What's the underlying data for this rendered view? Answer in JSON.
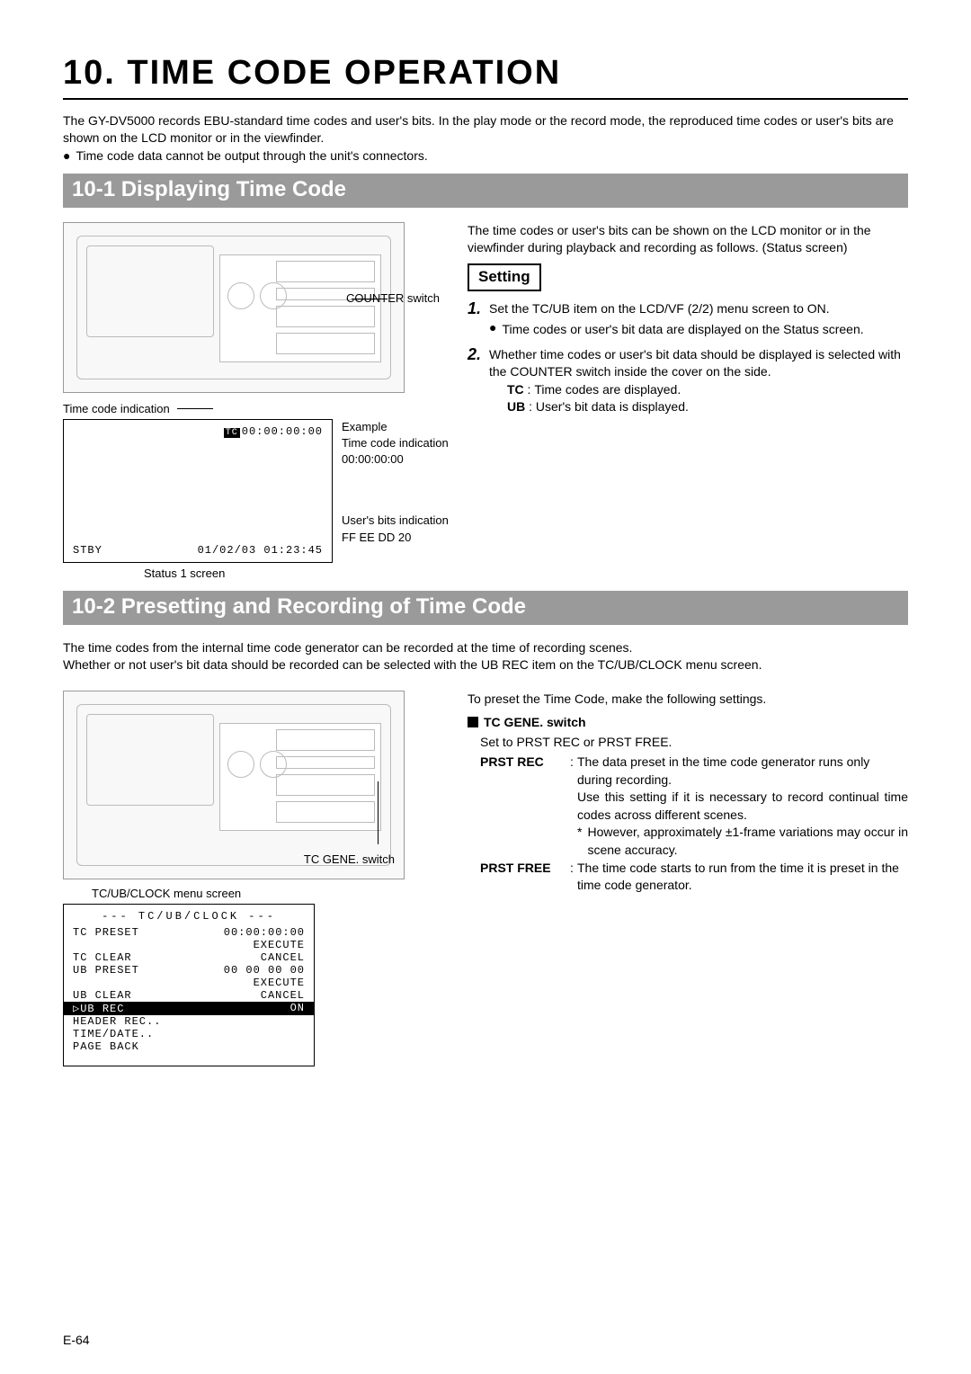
{
  "chapter": "10. TIME CODE OPERATION",
  "intro_p": "The GY-DV5000 records EBU-standard time codes and user's bits. In the play mode or the record mode, the reproduced time codes or user's bits are shown on the LCD monitor or in the viewfinder.",
  "intro_bullet": "Time code data cannot be output through the unit's connectors.",
  "sec1_bar": "10-1  Displaying Time Code",
  "sec1_right_intro": "The time codes or user's bits can be shown on the LCD monitor or in the viewfinder during playback and recording as follows. (Status screen)",
  "setting_label": "Setting",
  "step1_text": "Set the TC/UB item on the LCD/VF (2/2) menu screen to ON.",
  "step1_sub": "Time codes or user's bit data are displayed on the Status screen.",
  "step2_text": "Whether time codes or user's bit data should be displayed is selected with the COUNTER switch inside the cover on the side.",
  "step2_tc": "Time codes are displayed.",
  "step2_ub": "User's bit data is displayed.",
  "counter_switch_label": "COUNTER switch",
  "tc_indication_label": "Time code indication",
  "status_tc_value": "00:00:00:00",
  "status_stby": "STBY",
  "status_dt": "01/02/03 01:23:45",
  "status_caption": "Status 1 screen",
  "example_label": "Example",
  "example_tc_label": "Time code indication",
  "example_tc_val": "00:00:00:00",
  "example_ub_label": "User's bits indication",
  "example_ub_val": "FF EE DD 20",
  "sec2_bar": "10-2  Presetting and Recording of Time Code",
  "sec2_intro1": "The time codes from the internal time code generator can be recorded at the time of recording scenes.",
  "sec2_intro2": "Whether or not user's bit data should be recorded can be selected with the UB REC item on the TC/UB/CLOCK menu screen.",
  "preset_lead": "To preset the Time Code, make the following settings.",
  "tc_gene_hdr": "TC GENE. switch",
  "tc_gene_set": "Set to PRST REC or PRST FREE.",
  "prst_rec_label": "PRST REC",
  "prst_rec_1": "The data preset in the time code generator runs only during recording.",
  "prst_rec_2": "Use this setting if it is necessary to record continual time codes across different scenes.",
  "prst_rec_star": "However, approximately ±1-frame variations may occur in scene accuracy.",
  "prst_free_label": "PRST FREE",
  "prst_free_1": "The time code starts to run from the time it is preset in the time code generator.",
  "tc_gene_switch_label": "TC GENE. switch",
  "menu_caption": "TC/UB/CLOCK menu screen",
  "menu": {
    "hdr": "--- TC/UB/CLOCK ---",
    "r1l": "TC PRESET",
    "r1r": "00:00:00:00",
    "r2r": "EXECUTE",
    "r3l": "TC CLEAR",
    "r3r": "CANCEL",
    "r4l": "UB PRESET",
    "r4r": "00 00 00 00",
    "r5r": "EXECUTE",
    "r6l": "UB CLEAR",
    "r6r": "CANCEL",
    "r7l": "▷UB REC",
    "r7r": "ON",
    "r8l": "HEADER REC..",
    "r9l": "TIME/DATE..",
    "r10l": "PAGE BACK"
  },
  "page_num": "E-64"
}
